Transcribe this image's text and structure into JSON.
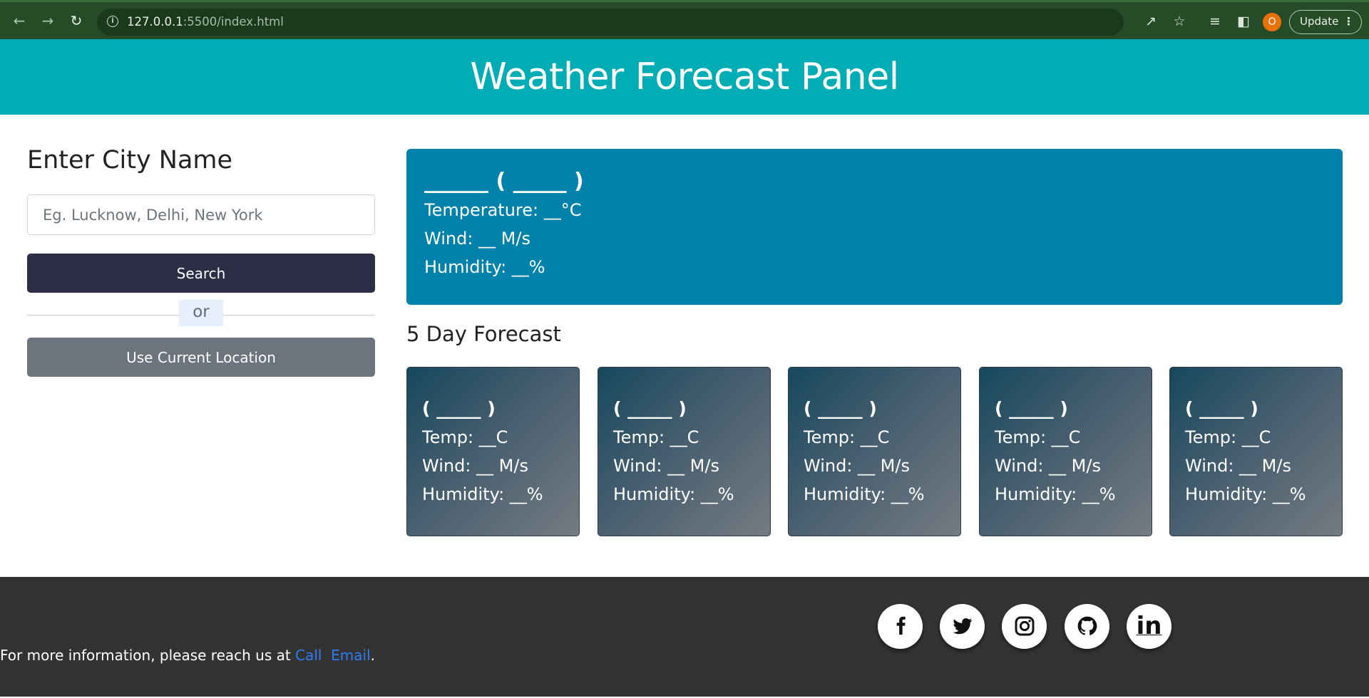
{
  "browser": {
    "url_host": "127.0.0.1",
    "url_rest": ":5500/index.html",
    "profile_initial": "O",
    "update_label": "Update"
  },
  "header": {
    "title": "Weather Forecast Panel"
  },
  "search": {
    "title": "Enter City Name",
    "placeholder": "Eg. Lucknow, Delhi, New York",
    "value": "",
    "search_label": "Search",
    "or_label": "or",
    "location_label": "Use Current Location"
  },
  "current": {
    "title": "______ ( _____ )",
    "temperature": "Temperature: __°C",
    "wind": "Wind: __ M/s",
    "humidity": "Humidity: __%"
  },
  "forecast": {
    "title": "5 Day Forecast",
    "days": [
      {
        "date": "( _____ )",
        "temp": "Temp: __C",
        "wind": "Wind: __ M/s",
        "humidity": "Humidity: __%"
      },
      {
        "date": "( _____ )",
        "temp": "Temp: __C",
        "wind": "Wind: __ M/s",
        "humidity": "Humidity: __%"
      },
      {
        "date": "( _____ )",
        "temp": "Temp: __C",
        "wind": "Wind: __ M/s",
        "humidity": "Humidity: __%"
      },
      {
        "date": "( _____ )",
        "temp": "Temp: __C",
        "wind": "Wind: __ M/s",
        "humidity": "Humidity: __%"
      },
      {
        "date": "( _____ )",
        "temp": "Temp: __C",
        "wind": "Wind: __ M/s",
        "humidity": "Humidity: __%"
      }
    ]
  },
  "footer": {
    "text_prefix": "For more information, please reach us at ",
    "call_label": "Call",
    "email_label": "Email",
    "text_suffix": ".",
    "social": [
      "facebook-icon",
      "twitter-icon",
      "instagram-icon",
      "github-icon",
      "linkedin-icon"
    ],
    "linkedin_label": "in"
  },
  "colors": {
    "header_bg": "#00adb5",
    "current_card_bg": "#0082ab",
    "search_button_bg": "#2b2e45",
    "location_button_bg": "#6c757d",
    "footer_bg": "#333333",
    "link": "#2f7df2"
  }
}
